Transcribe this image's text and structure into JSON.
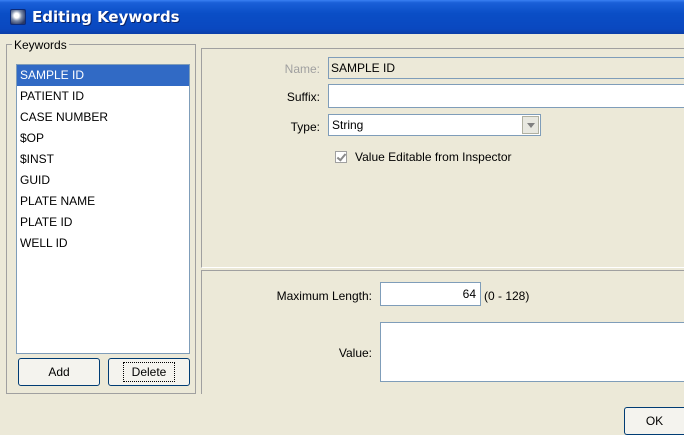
{
  "window": {
    "title": "Editing Keywords",
    "icon": "app-icon"
  },
  "keywords": {
    "legend": "Keywords",
    "items": [
      {
        "label": "SAMPLE ID",
        "selected": true
      },
      {
        "label": "PATIENT ID",
        "selected": false
      },
      {
        "label": "CASE NUMBER",
        "selected": false
      },
      {
        "label": "$OP",
        "selected": false
      },
      {
        "label": "$INST",
        "selected": false
      },
      {
        "label": "GUID",
        "selected": false
      },
      {
        "label": "PLATE NAME",
        "selected": false
      },
      {
        "label": "PLATE ID",
        "selected": false
      },
      {
        "label": "WELL ID",
        "selected": false
      }
    ],
    "add_label": "Add",
    "delete_label": "Delete"
  },
  "details": {
    "name_label": "Name:",
    "name_value": "SAMPLE ID",
    "suffix_label": "Suffix:",
    "suffix_value": "",
    "type_label": "Type:",
    "type_value": "String",
    "editable_label": "Value Editable from Inspector",
    "editable_checked": true
  },
  "constraints": {
    "max_length_label": "Maximum Length:",
    "max_length_value": "64",
    "range_text": "(0 - 128)",
    "value_label": "Value:",
    "value_value": ""
  },
  "footer": {
    "ok_label": "OK"
  },
  "colors": {
    "titlebar": "#0a4ec6",
    "selection": "#316ac5",
    "window_bg": "#ece9d8"
  }
}
